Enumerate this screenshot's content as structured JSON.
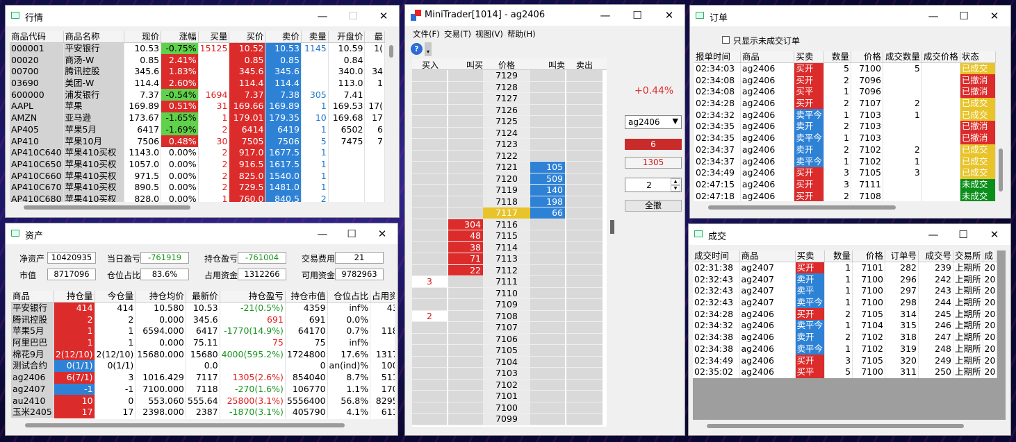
{
  "quote": {
    "title": "行情",
    "headers": [
      "商品代码",
      "商品名称",
      "现价",
      "涨幅",
      "买量",
      "买价",
      "卖价",
      "卖量",
      "开盘价",
      "最"
    ],
    "rows": [
      [
        "000001",
        "平安银行",
        "10.53",
        "-0.75%",
        "15125",
        "10.52",
        "10.53",
        "1145",
        "10.59",
        "1("
      ],
      [
        "00020",
        "商汤-W",
        "0.85",
        "2.41%",
        "",
        "0.85",
        "0.85",
        "",
        "0.84",
        ""
      ],
      [
        "00700",
        "腾讯控股",
        "345.6",
        "1.83%",
        "",
        "345.6",
        "345.6",
        "",
        "340.0",
        "34"
      ],
      [
        "03690",
        "美团-W",
        "114.4",
        "2.60%",
        "",
        "114.4",
        "114.4",
        "",
        "113.0",
        "1"
      ],
      [
        "600000",
        "浦发银行",
        "7.37",
        "-0.54%",
        "1694",
        "7.37",
        "7.38",
        "305",
        "7.41",
        ""
      ],
      [
        "AAPL",
        "苹果",
        "169.89",
        "0.51%",
        "31",
        "169.66",
        "169.89",
        "1",
        "169.53",
        "17("
      ],
      [
        "AMZN",
        "亚马逊",
        "173.67",
        "-1.65%",
        "1",
        "179.01",
        "179.35",
        "10",
        "169.68",
        "17"
      ],
      [
        "AP405",
        "苹果5月",
        "6417",
        "-1.69%",
        "2",
        "6414",
        "6419",
        "1",
        "6502",
        "6"
      ],
      [
        "AP410",
        "苹果10月",
        "7506",
        "0.48%",
        "30",
        "7505",
        "7506",
        "5",
        "7475",
        "7"
      ],
      [
        "AP410C640",
        "苹果410买权",
        "1143.0",
        "0.00%",
        "2",
        "917.0",
        "1677.5",
        "1",
        "",
        ""
      ],
      [
        "AP410C650",
        "苹果410买权",
        "1057.0",
        "0.00%",
        "2",
        "916.5",
        "1617.5",
        "1",
        "",
        ""
      ],
      [
        "AP410C660",
        "苹果410买权",
        "971.5",
        "0.00%",
        "2",
        "825.0",
        "1540.0",
        "1",
        "",
        ""
      ],
      [
        "AP410C670",
        "苹果410买权",
        "890.5",
        "0.00%",
        "2",
        "729.5",
        "1481.0",
        "1",
        "",
        ""
      ],
      [
        "AP410C680",
        "苹果410买权",
        "828.0",
        "0.00%",
        "1",
        "760.0",
        "840.5",
        "2",
        "",
        ""
      ]
    ]
  },
  "assets": {
    "title": "资产",
    "summary": [
      {
        "label": "净资产",
        "value": "10420935"
      },
      {
        "label": "当日盈亏",
        "value": "-761919"
      },
      {
        "label": "持仓盈亏",
        "value": "-761004"
      },
      {
        "label": "交易费用",
        "value": "21"
      },
      {
        "label": "市值",
        "value": "8717096"
      },
      {
        "label": "仓位占比",
        "value": "83.6%"
      },
      {
        "label": "占用资金",
        "value": "1312266"
      },
      {
        "label": "可用资金",
        "value": "9782963"
      }
    ],
    "headers": [
      "商品",
      "持仓量",
      "今仓量",
      "持仓均价",
      "最新价",
      "持仓盈亏",
      "持仓市值",
      "仓位占比",
      "占用资"
    ],
    "rows": [
      [
        "平安银行",
        "414",
        "414",
        "10.580",
        "10.53",
        "-21(0.5%)",
        "4359",
        "inf%",
        "43"
      ],
      [
        "腾讯控股",
        "2",
        "2",
        "0.000",
        "345.6",
        "691",
        "691",
        "0.0%",
        ""
      ],
      [
        "苹果5月",
        "1",
        "1",
        "6594.000",
        "6417",
        "-1770(14.9%)",
        "64170",
        "0.7%",
        "118"
      ],
      [
        "阿里巴巴",
        "1",
        "1",
        "0.000",
        "75.11",
        "75",
        "75",
        "inf%",
        ""
      ],
      [
        "棉花9月",
        "2(12/10)",
        "2(12/10)",
        "15680.000",
        "15680",
        "4000(595.2%)",
        "1724800",
        "17.6%",
        "1317"
      ],
      [
        "测试合约",
        "0(1/1)",
        "0(1/1)",
        "",
        "0.0",
        "",
        "0",
        "an(ind)%",
        "100"
      ],
      [
        "ag2406",
        "6(7/1)",
        "3",
        "1016.429",
        "7117",
        "1305(2.6%)",
        "854040",
        "8.7%",
        "511"
      ],
      [
        "ag2407",
        "-1",
        "-1",
        "7100.000",
        "7118",
        "-270(1.6%)",
        "106770",
        "1.1%",
        "170"
      ],
      [
        "au2410",
        "10",
        "0",
        "553.060",
        "555.64",
        "25800(3.1%)",
        "5556400",
        "56.8%",
        "8295"
      ],
      [
        "玉米2405",
        "17",
        "17",
        "2398.000",
        "2387",
        "-1870(3.1%)",
        "405790",
        "4.1%",
        "611"
      ]
    ]
  },
  "trader": {
    "title": "MiniTrader[1014] - ag2406",
    "menu": [
      "文件(F)",
      "交易(T)",
      "视图(V)",
      "帮助(H)"
    ],
    "headers": [
      "买入",
      "叫买",
      "价格",
      "叫卖",
      "卖出"
    ],
    "change": "+0.44%",
    "symbol": "ag2406",
    "position": "6",
    "pnl": "1305",
    "qty": "2",
    "cancel_all": "全撤",
    "ladder": [
      {
        "price": "7129"
      },
      {
        "price": "7128"
      },
      {
        "price": "7127"
      },
      {
        "price": "7126"
      },
      {
        "price": "7125"
      },
      {
        "price": "7124"
      },
      {
        "price": "7123"
      },
      {
        "price": "7122"
      },
      {
        "price": "7121",
        "ask": "105"
      },
      {
        "price": "7120",
        "ask": "509"
      },
      {
        "price": "7119",
        "ask": "140"
      },
      {
        "price": "7118",
        "ask": "198"
      },
      {
        "price": "7117",
        "ask": "66",
        "last": true
      },
      {
        "price": "7116",
        "bid": "304"
      },
      {
        "price": "7115",
        "bid": "48"
      },
      {
        "price": "7114",
        "bid": "38"
      },
      {
        "price": "7113",
        "bid": "71"
      },
      {
        "price": "7112",
        "bid": "22"
      },
      {
        "price": "7111",
        "buy": "3"
      },
      {
        "price": "7110"
      },
      {
        "price": "7109"
      },
      {
        "price": "7108",
        "buy": "2"
      },
      {
        "price": "7107"
      },
      {
        "price": "7106"
      },
      {
        "price": "7105"
      },
      {
        "price": "7104"
      },
      {
        "price": "7103"
      },
      {
        "price": "7102"
      },
      {
        "price": "7101"
      },
      {
        "price": "7100"
      },
      {
        "price": "7099"
      }
    ]
  },
  "orders": {
    "title": "订单",
    "checkbox_label": "只显示未成交订单",
    "headers": [
      "报单时间",
      "商品",
      "买卖",
      "数量",
      "价格",
      "成交数量",
      "成交价格",
      "状态"
    ],
    "rows": [
      [
        "02:34:03",
        "ag2406",
        "买开",
        "5",
        "7100",
        "5",
        "",
        "已成交"
      ],
      [
        "02:34:08",
        "ag2406",
        "买开",
        "2",
        "7096",
        "",
        "",
        "已撤消"
      ],
      [
        "02:34:08",
        "ag2406",
        "买平",
        "1",
        "7096",
        "",
        "",
        "已撤消"
      ],
      [
        "02:34:28",
        "ag2406",
        "买开",
        "2",
        "7107",
        "2",
        "",
        "已成交"
      ],
      [
        "02:34:32",
        "ag2406",
        "卖平今",
        "1",
        "7103",
        "1",
        "",
        "已成交"
      ],
      [
        "02:34:35",
        "ag2406",
        "卖开",
        "2",
        "7103",
        "",
        "",
        "已撤消"
      ],
      [
        "02:34:35",
        "ag2406",
        "卖平今",
        "1",
        "7103",
        "",
        "",
        "已撤消"
      ],
      [
        "02:34:37",
        "ag2406",
        "卖开",
        "2",
        "7102",
        "2",
        "",
        "已成交"
      ],
      [
        "02:34:37",
        "ag2406",
        "卖平今",
        "1",
        "7102",
        "1",
        "",
        "已成交"
      ],
      [
        "02:34:49",
        "ag2406",
        "买开",
        "3",
        "7105",
        "3",
        "",
        "已成交"
      ],
      [
        "02:47:15",
        "ag2406",
        "买开",
        "3",
        "7111",
        "",
        "",
        "未成交"
      ],
      [
        "02:47:18",
        "ag2406",
        "买开",
        "2",
        "7108",
        "",
        "",
        "未成交"
      ]
    ]
  },
  "trades": {
    "title": "成交",
    "headers": [
      "成交时间",
      "商品",
      "买卖",
      "数量",
      "价格",
      "订单号",
      "成交号",
      "交易所",
      "成"
    ],
    "rows": [
      [
        "02:31:38",
        "ag2407",
        "买开",
        "1",
        "7101",
        "282",
        "239",
        "上期所",
        "20"
      ],
      [
        "02:32:43",
        "ag2407",
        "卖开",
        "1",
        "7100",
        "296",
        "242",
        "上期所",
        "20"
      ],
      [
        "02:32:43",
        "ag2407",
        "卖平",
        "1",
        "7100",
        "297",
        "243",
        "上期所",
        "20"
      ],
      [
        "02:32:43",
        "ag2407",
        "卖平今",
        "1",
        "7100",
        "298",
        "244",
        "上期所",
        "20"
      ],
      [
        "02:34:28",
        "ag2406",
        "买开",
        "2",
        "7105",
        "314",
        "245",
        "上期所",
        "20"
      ],
      [
        "02:34:32",
        "ag2406",
        "卖平今",
        "1",
        "7104",
        "315",
        "246",
        "上期所",
        "20"
      ],
      [
        "02:34:38",
        "ag2406",
        "卖开",
        "2",
        "7102",
        "318",
        "247",
        "上期所",
        "20"
      ],
      [
        "02:34:38",
        "ag2406",
        "卖平今",
        "1",
        "7102",
        "319",
        "248",
        "上期所",
        "20"
      ],
      [
        "02:34:49",
        "ag2406",
        "买开",
        "3",
        "7105",
        "320",
        "249",
        "上期所",
        "20"
      ],
      [
        "02:35:02",
        "ag2406",
        "买平",
        "5",
        "7100",
        "311",
        "250",
        "上期所",
        "20"
      ]
    ]
  },
  "window_buttons": {
    "min": "—",
    "max": "☐",
    "close": "✕"
  },
  "colors": {
    "red": "#dc2b2b",
    "blue": "#2e82d6",
    "green": "#5fd14a",
    "yellow": "#e8c42a",
    "dark_green": "#0a8f1a"
  }
}
